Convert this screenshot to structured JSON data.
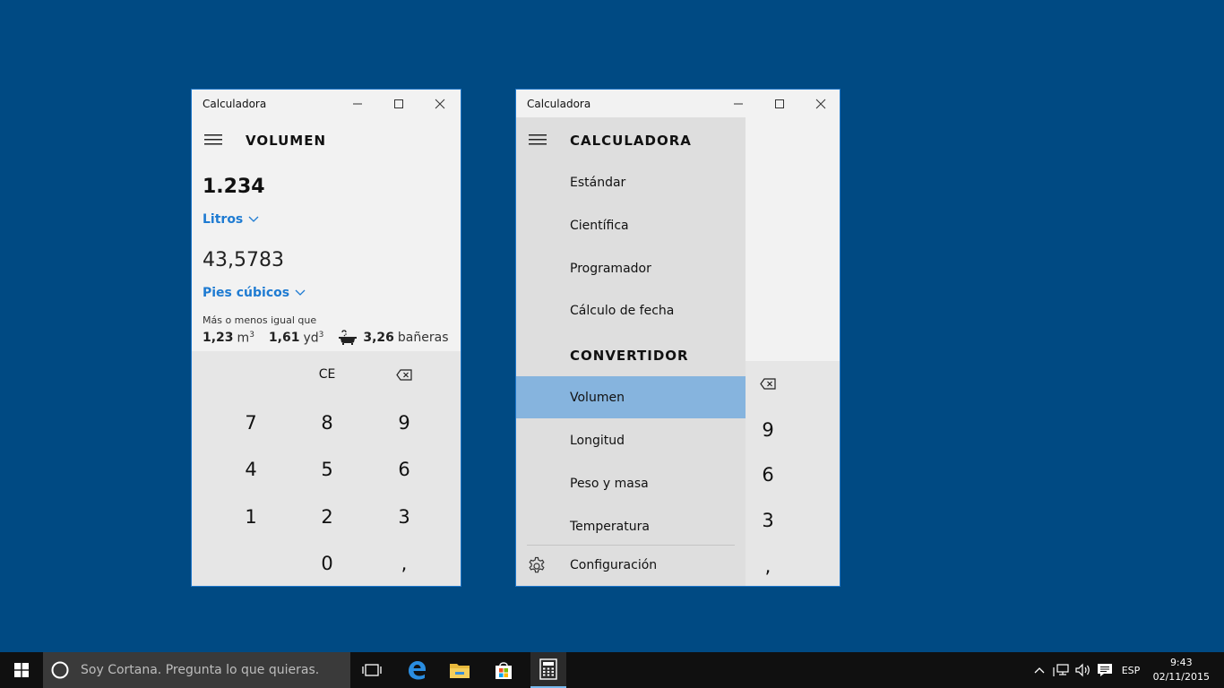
{
  "colors": {
    "desktop": "#004a83",
    "accent": "#1e7bd2",
    "nav_selected": "#86b4de",
    "taskbar": "#101010"
  },
  "window1": {
    "title": "Calculadora",
    "mode": "VOLUMEN",
    "input_value": "1.234",
    "input_unit": "Litros",
    "output_value": "43,5783",
    "output_unit": "Pies cúbicos",
    "approx_label": "Más o menos igual que",
    "approx": [
      {
        "value": "1,23",
        "unit": "m",
        "sup": "3"
      },
      {
        "value": "1,61",
        "unit": "yd",
        "sup": "3"
      },
      {
        "value": "3,26",
        "unit": "bañeras",
        "icon": "bathtub-icon"
      }
    ],
    "keys": {
      "ce": "CE",
      "k7": "7",
      "k8": "8",
      "k9": "9",
      "k4": "4",
      "k5": "5",
      "k6": "6",
      "k1": "1",
      "k2": "2",
      "k3": "3",
      "k0": "0",
      "decimal": ","
    }
  },
  "window2": {
    "title": "Calculadora",
    "menu": {
      "section_calculator": "CALCULADORA",
      "calculator_items": [
        "Estándar",
        "Científica",
        "Programador",
        "Cálculo de fecha"
      ],
      "section_converter": "CONVERTIDOR",
      "converter_items": [
        "Volumen",
        "Longitud",
        "Peso y masa",
        "Temperatura"
      ],
      "selected": "Volumen",
      "settings": "Configuración"
    },
    "keys": {
      "k9": "9",
      "k6": "6",
      "k3": "3",
      "decimal": ","
    }
  },
  "taskbar": {
    "search_placeholder": "Soy Cortana. Pregunta lo que quieras.",
    "language": "ESP",
    "time": "9:43",
    "date": "02/11/2015"
  }
}
